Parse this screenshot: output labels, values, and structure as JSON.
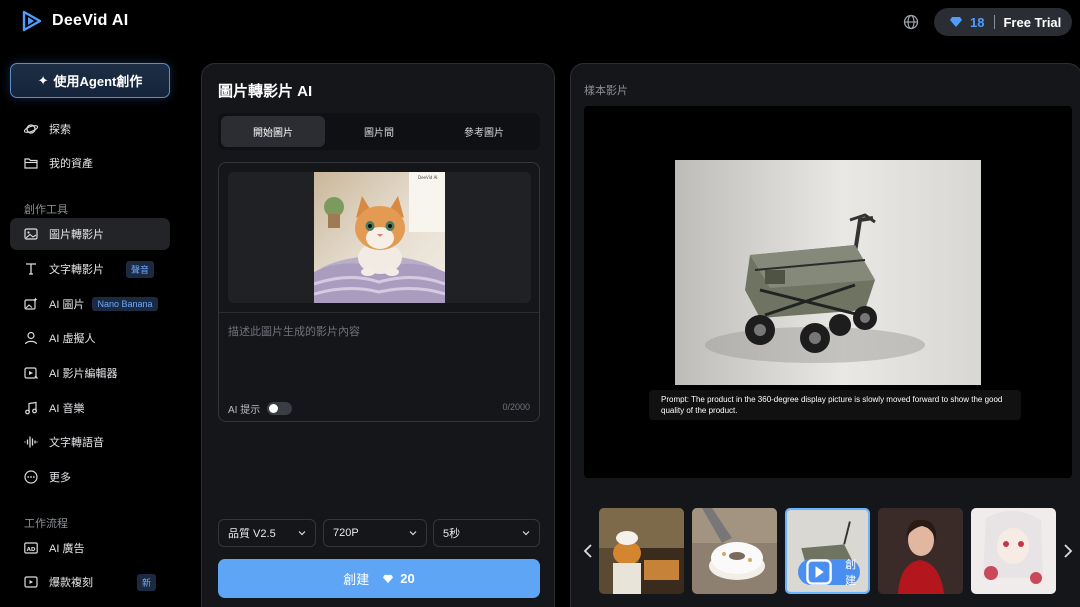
{
  "app": {
    "name": "DeeVid AI",
    "credits": "18",
    "trial_label": "Free Trial"
  },
  "sidebar": {
    "agent_button": "使用Agent創作",
    "top_items": [
      {
        "label": "探索",
        "icon": "planet-icon"
      },
      {
        "label": "我的資產",
        "icon": "folder-icon"
      }
    ],
    "section_tools": "創作工具",
    "tools": [
      {
        "label": "圖片轉影片",
        "icon": "image-icon",
        "active": true
      },
      {
        "label": "文字轉影片",
        "icon": "text-icon",
        "badge": "聲音"
      },
      {
        "label": "AI 圖片",
        "icon": "image-sparkle-icon",
        "badge": "Nano Banana"
      },
      {
        "label": "AI 虛擬人",
        "icon": "person-icon"
      },
      {
        "label": "AI 影片編輯器",
        "icon": "video-edit-icon"
      },
      {
        "label": "AI 音樂",
        "icon": "music-icon"
      },
      {
        "label": "文字轉語音",
        "icon": "waveform-icon"
      },
      {
        "label": "更多",
        "icon": "more-icon"
      }
    ],
    "section_workflow": "工作流程",
    "workflow": [
      {
        "label": "AI 廣告",
        "icon": "ad-icon"
      },
      {
        "label": "爆款複刻",
        "icon": "replicate-icon",
        "badge": "新"
      }
    ]
  },
  "editor": {
    "title": "圖片轉影片 AI",
    "tabs": [
      "開始圖片",
      "圖片間",
      "參考圖片"
    ],
    "active_tab": 0,
    "image_watermark": "DeeVid AI",
    "prompt_placeholder": "描述此圖片生成的影片內容",
    "ai_hint_label": "AI 提示",
    "char_counter": "0/2000",
    "quality": "品質 V2.5",
    "resolution": "720P",
    "duration": "5秒",
    "create_label": "創建",
    "create_cost": "20"
  },
  "sample": {
    "label": "樣本影片",
    "prompt_caption": "Prompt:  The product in the 360-degree display picture is slowly moved forward to show the good quality of the product.",
    "thumb_create_label": "創建"
  },
  "colors": {
    "accent": "#5ea6f5",
    "brand": "#4e9dff",
    "background": "#000000",
    "panel": "#15161a"
  }
}
